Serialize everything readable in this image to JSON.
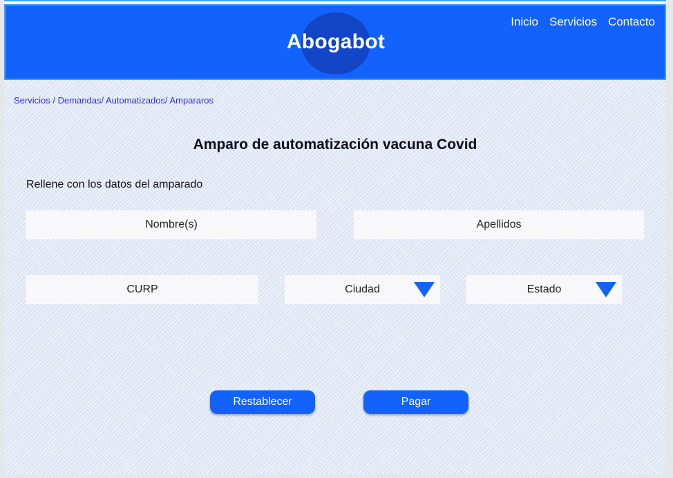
{
  "header": {
    "brand": "Abogabot",
    "nav": [
      "Inicio",
      "Servicios",
      "Contacto"
    ]
  },
  "breadcrumb": "Servicios / Demandas/ Automatizados/ Ampararos",
  "form": {
    "title": "Amparo de automatización vacuna Covid",
    "instruction": "Rellene con los datos del amparado",
    "fields": {
      "nombre": "Nombre(s)",
      "apellidos": "Apellidos",
      "curp": "CURP",
      "ciudad": "Ciudad",
      "estado": "Estado"
    },
    "buttons": {
      "reset": "Restablecer",
      "pay": "Pagar"
    }
  },
  "colors": {
    "primary": "#1262fb",
    "logo_circle": "#1246c6",
    "breadcrumb": "#2f2ff0"
  }
}
